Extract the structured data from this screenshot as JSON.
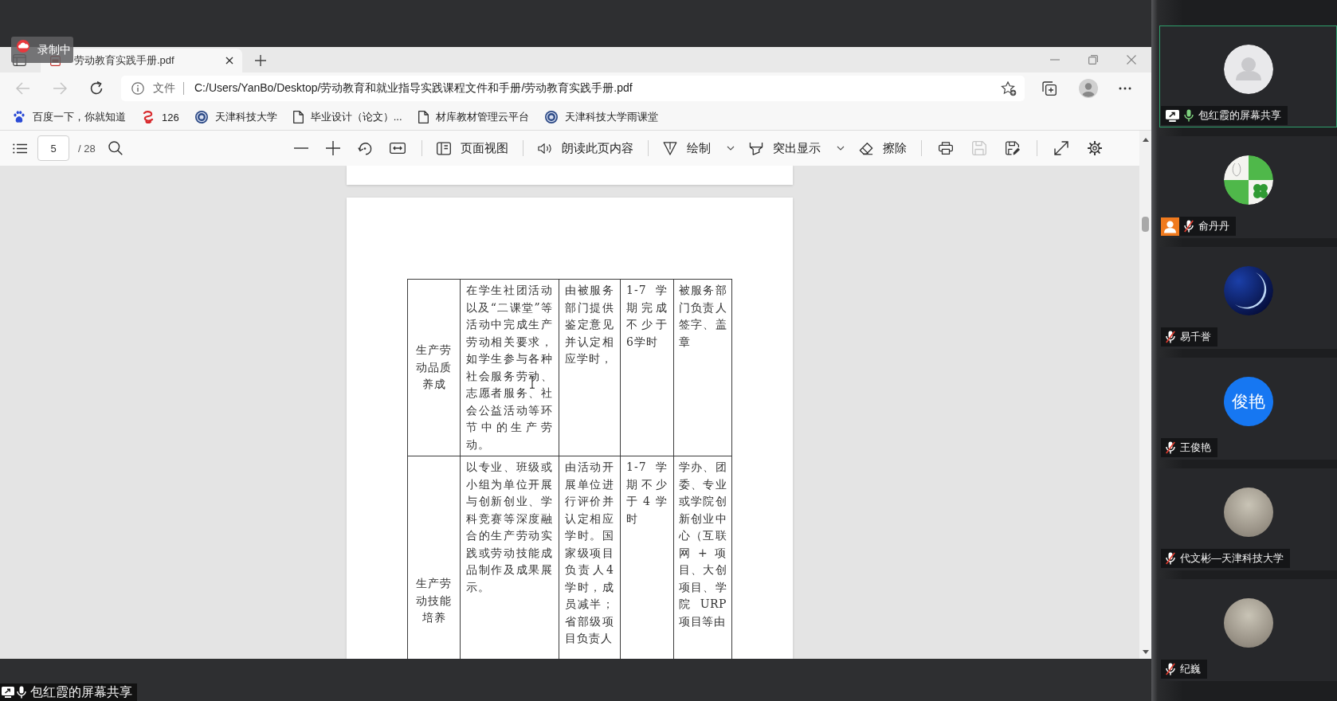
{
  "recording_badge": {
    "label": "录制中"
  },
  "browser": {
    "tabs": [
      {
        "title": "劳动教育实践手册.pdf",
        "selected": true
      }
    ],
    "nav_buttons": [
      {
        "kind": "back",
        "disabled": true
      },
      {
        "kind": "forward",
        "disabled": true
      },
      {
        "kind": "reload",
        "disabled": false
      }
    ],
    "address_bar": {
      "scheme": "文件",
      "url": "C:/Users/YanBo/Desktop/劳动教育和就业指导实践课程文件和手册/劳动教育实践手册.pdf"
    },
    "bookmarks": [
      {
        "kind": "paw",
        "label": "百度一下，你就知道"
      },
      {
        "kind": "swirl",
        "label": "126"
      },
      {
        "kind": "emblem",
        "label": "天津科技大学"
      },
      {
        "kind": "page",
        "label": "毕业设计（论文）..."
      },
      {
        "kind": "page",
        "label": "材库教材管理云平台"
      },
      {
        "kind": "emblem",
        "label": "天津科技大学雨课堂"
      }
    ]
  },
  "pdf_viewer": {
    "page_number": "5",
    "page_count": "/ 28",
    "tools": [
      {
        "kind": "page-view",
        "label": "页面视图",
        "dropdown": false
      },
      {
        "kind": "read-aloud",
        "label": "朗读此页内容",
        "dropdown": false
      },
      {
        "kind": "draw",
        "label": "绘制",
        "dropdown": true
      },
      {
        "kind": "highlight",
        "label": "突出显示",
        "dropdown": true
      },
      {
        "kind": "erase",
        "label": "擦除",
        "dropdown": false
      }
    ],
    "file_actions": [
      {
        "kind": "print",
        "disabled": false
      },
      {
        "kind": "save",
        "disabled": true
      },
      {
        "kind": "save-as",
        "disabled": false
      }
    ],
    "table": {
      "rows": [
        [
          "生产劳动品质养成",
          "在学生社团活动以及“二课堂”等活动中完成生产劳动相关要求，如学生参与各种社会服务劳动、志愿者服务、社会公益活动等环节中的生产劳动。",
          "由被服务部门提供鉴定意见并认定相应学时，",
          "1-7 学期完成不少于6学时",
          "被服务部门负责人签字、盖章"
        ],
        [
          "生产劳动技能培养",
          "以专业、班级或小组为单位开展与创新创业、学科竞赛等深度融合的生产劳动实践或劳动技能成品制作及成果展示。",
          "由活动开展单位进行评价并认定相应学时。国家级项目负责人4学时，成员减半；省部级项目负责人",
          "1-7 学期不少于4学时",
          "学办、团委、专业或学院创新创业中心（互联网+项目、大创项目、学院URP项目等由"
        ]
      ]
    }
  },
  "participants": [
    {
      "name": "包红霞的屏幕共享",
      "avatar": {
        "kind": "silhouette"
      },
      "active": true,
      "sharing": true,
      "person_badge": false,
      "muted": false
    },
    {
      "name": "俞丹丹",
      "avatar": {
        "kind": "clover"
      },
      "active": false,
      "sharing": false,
      "person_badge": true,
      "muted": true
    },
    {
      "name": "易千誉",
      "avatar": {
        "kind": "moon"
      },
      "active": false,
      "sharing": false,
      "person_badge": false,
      "muted": true
    },
    {
      "name": "王俊艳",
      "avatar": {
        "kind": "initials",
        "text": "俊艳"
      },
      "active": false,
      "sharing": false,
      "person_badge": false,
      "muted": true
    },
    {
      "name": "代文彬—天津科技大学",
      "avatar": {
        "kind": "photo"
      },
      "active": false,
      "sharing": false,
      "person_badge": false,
      "muted": true
    },
    {
      "name": "纪巍",
      "avatar": {
        "kind": "photo"
      },
      "active": false,
      "sharing": false,
      "person_badge": false,
      "muted": true
    }
  ],
  "share_label": {
    "text": "包红霞的屏幕共享",
    "muted": false
  }
}
